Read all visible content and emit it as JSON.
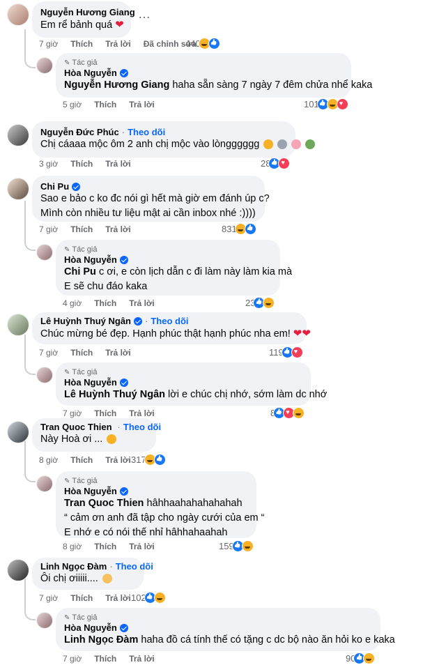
{
  "comments": {
    "c1": {
      "name": "Nguyễn Hương Giang",
      "text": "Em rể bảnh quá",
      "time": "7 giờ",
      "like": "Thích",
      "reply": "Trả lời",
      "edited": "Đã chỉnh sửa",
      "count": "440"
    },
    "r1": {
      "author_label": "Tác giả",
      "name": "Hòa Nguyễn",
      "tag": "Nguyễn Hương Giang",
      "text": "haha sẵn sàng 7 ngày 7 đêm chửa nhể kaka",
      "time": "5 giờ",
      "like": "Thích",
      "reply": "Trả lời",
      "count": "101"
    },
    "c2": {
      "name": "Nguyễn Đức Phúc",
      "follow": "Theo dõi",
      "text": "Chị cáaaa mộc ôm 2 anh chị mộc vào lòngggggg",
      "time": "3 giờ",
      "like": "Thích",
      "reply": "Trả lời",
      "count": "28"
    },
    "c3": {
      "name": "Chi Pu",
      "line1": "Sao e bảo c ko đc nói gì hết mà giờ em đánh úp c?",
      "line2": "Mình còn nhiều tư liệu mật ai cần inbox nhé :))))",
      "time": "7 giờ",
      "like": "Thích",
      "reply": "Trả lời",
      "count": "831"
    },
    "r3": {
      "author_label": "Tác giả",
      "name": "Hòa Nguyễn",
      "tag": "Chi Pu",
      "line1": "c ơi, e còn lịch dẫn c đi làm này làm kia mà",
      "line2": "E sẽ chu đáo kaka",
      "time": "4 giờ",
      "like": "Thích",
      "reply": "Trả lời",
      "count": "23"
    },
    "c4": {
      "name": "Lê Huỳnh Thuý Ngân",
      "follow": "Theo dõi",
      "text": "Chúc mừng bé đẹp. Hạnh phúc thật hạnh phúc nha em!",
      "time": "7 giờ",
      "like": "Thích",
      "reply": "Trả lời",
      "count": "119"
    },
    "r4": {
      "author_label": "Tác giả",
      "name": "Hòa Nguyễn",
      "tag": "Lê Huỳnh Thuý Ngân",
      "text": "lời e chúc chị nhớ, sớm làm dc nhớ",
      "time": "7 giờ",
      "like": "Thích",
      "reply": "Trả lời",
      "count": "8"
    },
    "c5": {
      "name": "Tran Quoc Thien",
      "follow": "Theo dõi",
      "text": "Này Hoà ơi ...",
      "time": "8 giờ",
      "like": "Thích",
      "reply": "Trả lời",
      "count": "317"
    },
    "r5": {
      "author_label": "Tác giả",
      "name": "Hòa Nguyễn",
      "tag": "Tran Quoc Thien",
      "line1": "hâhhaahahahahahah",
      "line2": "“ cảm ơn anh đã tập cho ngày cưới của em “",
      "line3": "E nhớ e có nói thế nhỉ hâhhahaahah",
      "time": "8 giờ",
      "like": "Thích",
      "reply": "Trả lời",
      "count": "159"
    },
    "c6": {
      "name": "Linh Ngọc Đàm",
      "follow": "Theo dõi",
      "text": "Ôi chị ơiiiii....",
      "time": "7 giờ",
      "like": "Thích",
      "reply": "Trả lời",
      "count": "102"
    },
    "r6": {
      "author_label": "Tác giả",
      "name": "Hòa Nguyễn",
      "tag": "Linh Ngọc Đàm",
      "text": "haha đồ cá tính thế có tặng c dc bộ nào ăn hỏi ko e kaka",
      "time": "7 giờ",
      "like": "Thích",
      "reply": "Trả lời",
      "count": "90"
    }
  },
  "more_label": "…",
  "dot": "·",
  "colors": {
    "link": "#0866ff",
    "bubble": "#f0f2f5",
    "muted": "#65676b"
  }
}
